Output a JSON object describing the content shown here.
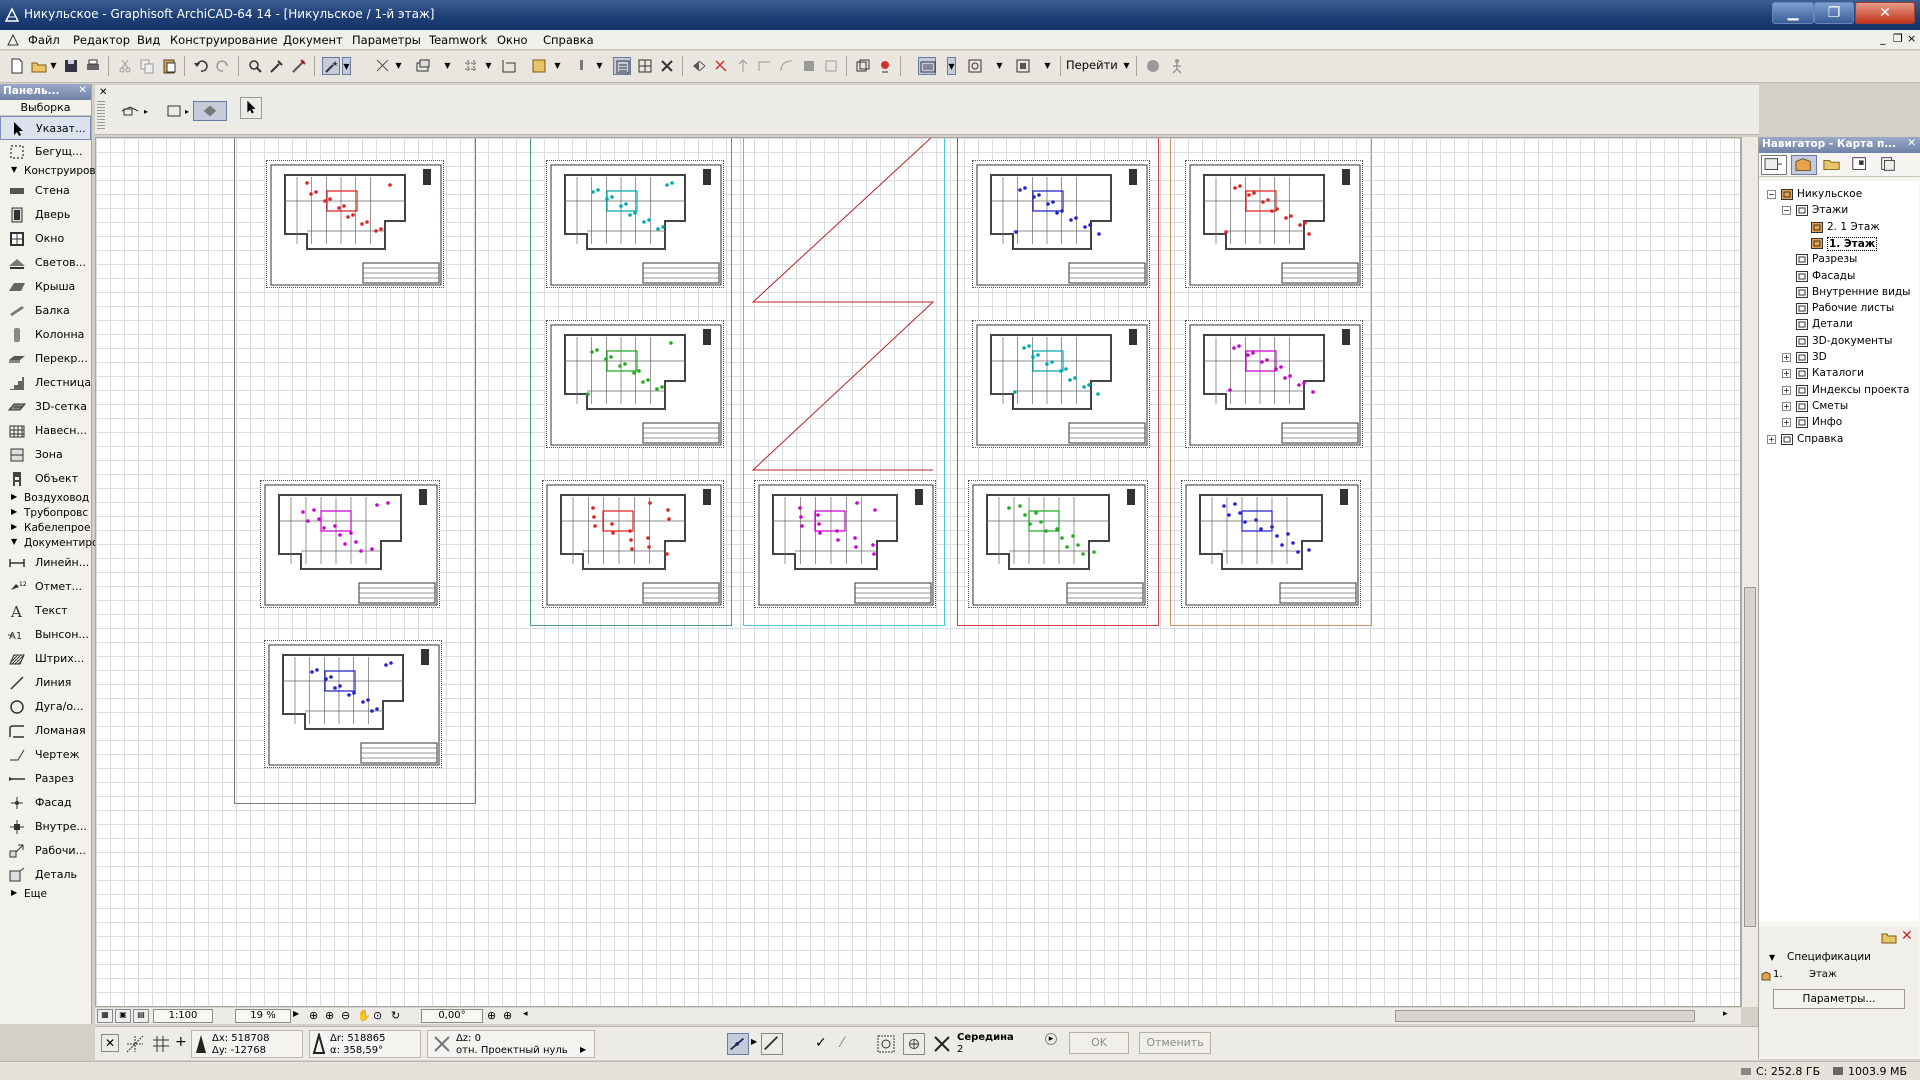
{
  "window": {
    "title": "Никульское - Graphisoft ArchiCAD-64 14 - [Никульское / 1-й этаж]",
    "min_glyph": "▁",
    "max_glyph": "❐",
    "close_glyph": "✕"
  },
  "menu": {
    "items": [
      "Файл",
      "Редактор",
      "Вид",
      "Конструирование",
      "Документ",
      "Параметры",
      "Teamwork",
      "Окно",
      "Справка"
    ],
    "mdi_controls": [
      "_",
      "❐",
      "×"
    ]
  },
  "toolbar": {
    "goto_label": "Перейти"
  },
  "toolbox": {
    "panel_title": "Панель...",
    "selection_label": "Выборка",
    "arrow_tools": [
      {
        "label": "Указат...",
        "icon": "pointer-icon"
      },
      {
        "label": "Бегущ...",
        "icon": "marquee-icon"
      }
    ],
    "design_group": "Конструирование",
    "design_tools": [
      {
        "label": "Стена",
        "icon": "wall-icon"
      },
      {
        "label": "Дверь",
        "icon": "door-icon"
      },
      {
        "label": "Окно",
        "icon": "window-icon"
      },
      {
        "label": "Светов...",
        "icon": "skylight-icon"
      },
      {
        "label": "Крыша",
        "icon": "roof-icon"
      },
      {
        "label": "Балка",
        "icon": "beam-icon"
      },
      {
        "label": "Колонна",
        "icon": "column-icon"
      },
      {
        "label": "Перекр...",
        "icon": "slab-icon"
      },
      {
        "label": "Лестница",
        "icon": "stair-icon"
      },
      {
        "label": "3D-сетка",
        "icon": "mesh-icon"
      },
      {
        "label": "Навесн...",
        "icon": "curtain-wall-icon"
      },
      {
        "label": "Зона",
        "icon": "zone-icon"
      },
      {
        "label": "Объект",
        "icon": "object-icon"
      }
    ],
    "collapsed_groups": [
      "Воздуховод",
      "Трубопровс",
      "Кабелепрое"
    ],
    "document_group": "Документиров",
    "document_tools": [
      {
        "label": "Линейн...",
        "icon": "dimension-icon"
      },
      {
        "label": "Отмет...",
        "icon": "level-dimension-icon"
      },
      {
        "label": "Текст",
        "icon": "text-icon"
      },
      {
        "label": "Вынсон...",
        "icon": "label-icon"
      },
      {
        "label": "Штрих...",
        "icon": "fill-icon"
      },
      {
        "label": "Линия",
        "icon": "line-icon"
      },
      {
        "label": "Дуга/о...",
        "icon": "arc-icon"
      },
      {
        "label": "Ломаная",
        "icon": "polyline-icon"
      },
      {
        "label": "Чертеж",
        "icon": "drawing-icon"
      },
      {
        "label": "Разрез",
        "icon": "section-icon"
      },
      {
        "label": "Фасад",
        "icon": "elevation-icon"
      },
      {
        "label": "Внутре...",
        "icon": "interior-elevation-icon"
      },
      {
        "label": "Рабочи...",
        "icon": "worksheet-icon"
      },
      {
        "label": "Деталь",
        "icon": "detail-icon"
      }
    ],
    "more_group": "Еще"
  },
  "canvas_bottom": {
    "scale": "1:100",
    "zoom": "19 %",
    "angle": "0,00°"
  },
  "coords": {
    "dx": "Δx: 518708",
    "dy": "Δy: -12768",
    "dr": "Δr: 518865",
    "da": "α: 358,59°",
    "dz": "Δz: 0",
    "ref": "отн. Проектный нуль",
    "snap_label": "Середина",
    "snap_value": "2",
    "ok_label": "OK",
    "cancel_label": "Отменить"
  },
  "status": {
    "disk": "C: 252.8 ГБ",
    "memory": "1003.9 МБ"
  },
  "navigator": {
    "panel_title": "Навигатор - Карта п...",
    "tree": [
      {
        "label": "Никульское",
        "level": 0,
        "expander": "−",
        "icon": "project-icon"
      },
      {
        "label": "Этажи",
        "level": 1,
        "expander": "−",
        "icon": "stories-icon"
      },
      {
        "label": "2. 1 Этаж",
        "level": 2,
        "expander": "",
        "icon": "story-icon"
      },
      {
        "label": "1. Этаж",
        "level": 2,
        "expander": "",
        "icon": "story-icon",
        "selected": true
      },
      {
        "label": "Разрезы",
        "level": 1,
        "expander": "",
        "icon": "sections-icon"
      },
      {
        "label": "Фасады",
        "level": 1,
        "expander": "",
        "icon": "elevations-icon"
      },
      {
        "label": "Внутренние виды",
        "level": 1,
        "expander": "",
        "icon": "interior-icon"
      },
      {
        "label": "Рабочие листы",
        "level": 1,
        "expander": "",
        "icon": "worksheets-icon"
      },
      {
        "label": "Детали",
        "level": 1,
        "expander": "",
        "icon": "details-icon"
      },
      {
        "label": "3D-документы",
        "level": 1,
        "expander": "",
        "icon": "3d-docs-icon"
      },
      {
        "label": "3D",
        "level": 1,
        "expander": "+",
        "icon": "3d-icon"
      },
      {
        "label": "Каталоги",
        "level": 1,
        "expander": "+",
        "icon": "schedules-icon"
      },
      {
        "label": "Индексы проекта",
        "level": 1,
        "expander": "+",
        "icon": "project-indexes-icon"
      },
      {
        "label": "Сметы",
        "level": 1,
        "expander": "+",
        "icon": "lists-icon"
      },
      {
        "label": "Инфо",
        "level": 1,
        "expander": "+",
        "icon": "info-icon"
      },
      {
        "label": "Справка",
        "level": 0,
        "expander": "+",
        "icon": "help-icon"
      }
    ],
    "spec_section": "Спецификации",
    "spec_number": "1.",
    "spec_name": "Этаж",
    "params_button": "Параметры..."
  },
  "colors": {
    "frame_cyan": "#44c8d8",
    "frame_red": "#d04040",
    "frame_orange": "#d09060",
    "frame_teal": "#4a9a8a",
    "frame_gray": "#777777"
  }
}
